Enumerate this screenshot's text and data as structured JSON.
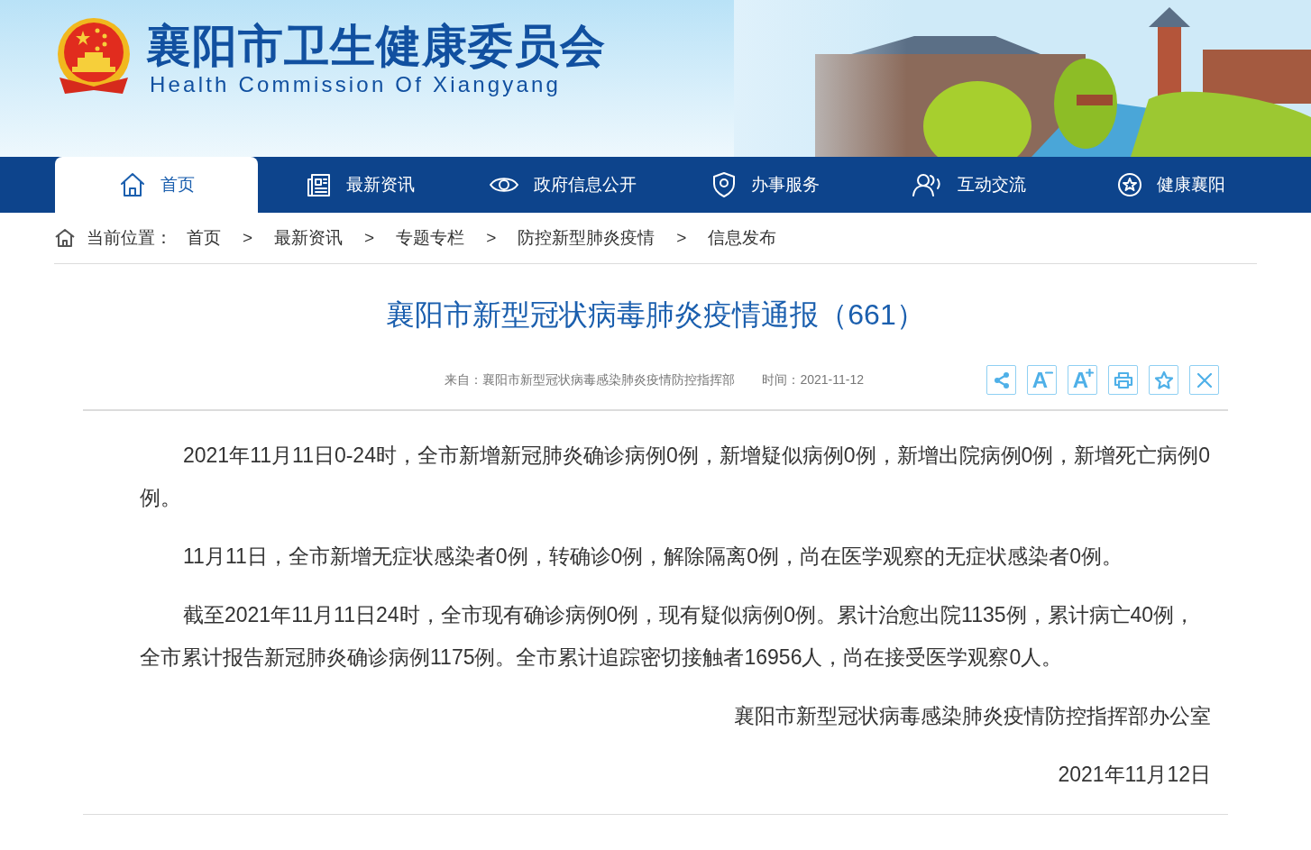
{
  "site": {
    "title": "襄阳市卫生健康委员会",
    "subtitle": "Health Commission Of Xiangyang"
  },
  "nav": [
    {
      "label": "首页",
      "selected": true
    },
    {
      "label": "最新资讯",
      "selected": false
    },
    {
      "label": "政府信息公开",
      "selected": false
    },
    {
      "label": "办事服务",
      "selected": false
    },
    {
      "label": "互动交流",
      "selected": false
    },
    {
      "label": "健康襄阳",
      "selected": false
    }
  ],
  "breadcrumb": {
    "label": "当前位置：",
    "items": [
      "首页",
      "最新资讯",
      "专题专栏",
      "防控新型肺炎疫情",
      "信息发布"
    ],
    "separator": ">"
  },
  "article": {
    "title": "襄阳市新型冠状病毒肺炎疫情通报（661）",
    "source": "来自：襄阳市新型冠状病毒感染肺炎疫情防控指挥部",
    "time": "时间：2021-11-12",
    "tools": [
      {
        "kind": "share"
      },
      {
        "kind": "smaller",
        "label": "A"
      },
      {
        "kind": "larger",
        "label": "A"
      },
      {
        "kind": "print"
      },
      {
        "kind": "favorite"
      },
      {
        "kind": "close"
      }
    ],
    "paragraphs": [
      "2021年11月11日0-24时，全市新增新冠肺炎确诊病例0例，新增疑似病例0例，新增出院病例0例，新增死亡病例0例。",
      "11月11日，全市新增无症状感染者0例，转确诊0例，解除隔离0例，尚在医学观察的无症状感染者0例。",
      "截至2021年11月11日24时，全市现有确诊病例0例，现有疑似病例0例。累计治愈出院1135例，累计病亡40例，全市累计报告新冠肺炎确诊病例1175例。全市累计追踪密切接触者16956人，尚在接受医学观察0人。"
    ],
    "signature": "襄阳市新型冠状病毒感染肺炎疫情防控指挥部办公室",
    "date": "2021年11月12日"
  }
}
